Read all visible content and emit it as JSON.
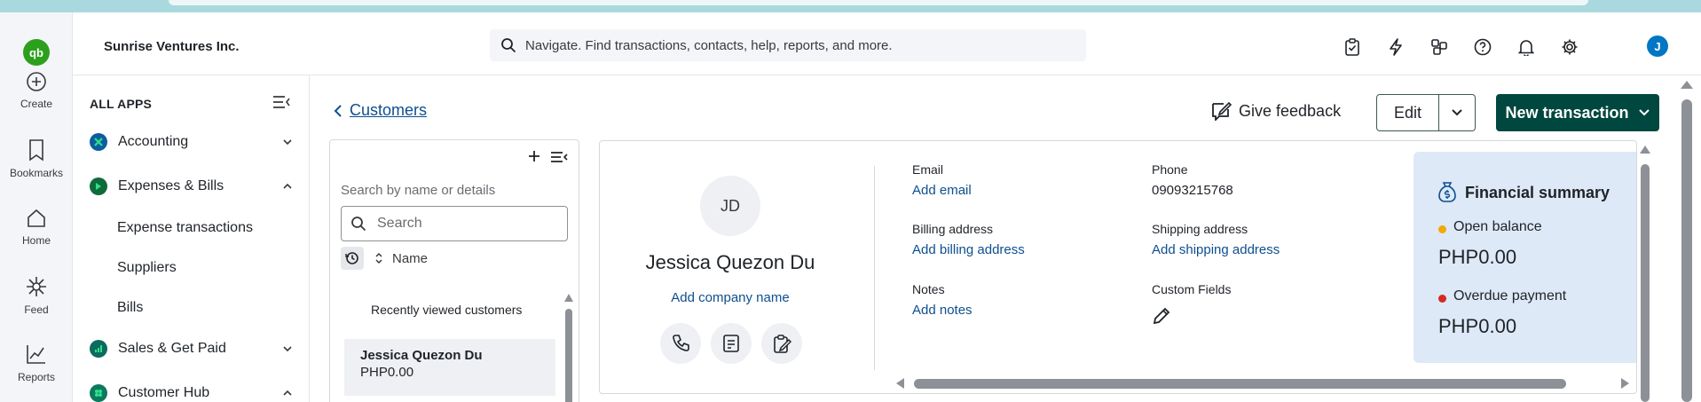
{
  "rail": {
    "items": [
      {
        "label": "Create",
        "icon": "plus-circle-icon"
      },
      {
        "label": "Bookmarks",
        "icon": "bookmark-icon"
      },
      {
        "label": "Home",
        "icon": "home-icon"
      },
      {
        "label": "Feed",
        "icon": "sparkle-icon"
      },
      {
        "label": "Reports",
        "icon": "line-chart-icon"
      }
    ],
    "logo_text": "qb"
  },
  "header": {
    "company": "Sunrise Ventures Inc.",
    "search_placeholder": "Navigate. Find transactions, contacts, help, reports, and more.",
    "avatar_initial": "J"
  },
  "nav": {
    "title": "ALL APPS",
    "items": [
      {
        "label": "Accounting",
        "color": "#0b5e9d",
        "expanded": false
      },
      {
        "label": "Expenses & Bills",
        "color": "#0f6b3a",
        "expanded": true
      },
      {
        "label": "Sales & Get Paid",
        "color": "#0b6b5e",
        "expanded": false
      },
      {
        "label": "Customer Hub",
        "color": "#0b7a5e",
        "expanded": true
      }
    ],
    "subitems": [
      "Expense transactions",
      "Suppliers",
      "Bills"
    ]
  },
  "main": {
    "back_label": "Customers",
    "feedback_label": "Give feedback",
    "edit_label": "Edit",
    "new_transaction_label": "New transaction"
  },
  "customer_list": {
    "hint": "Search by name or details",
    "search_placeholder": "Search",
    "sort_label": "Name",
    "recent_heading": "Recently viewed customers",
    "rows": [
      {
        "name": "Jessica Quezon Du",
        "balance": "PHP0.00"
      }
    ]
  },
  "customer": {
    "initials": "JD",
    "name": "Jessica Quezon Du",
    "add_company": "Add company name",
    "email_label": "Email",
    "email_link": "Add email",
    "phone_label": "Phone",
    "phone_value": "09093215768",
    "billing_label": "Billing address",
    "billing_link": "Add billing address",
    "shipping_label": "Shipping address",
    "shipping_link": "Add shipping address",
    "notes_label": "Notes",
    "notes_link": "Add notes",
    "custom_fields_label": "Custom Fields"
  },
  "financial_summary": {
    "title": "Financial summary",
    "open_balance_label": "Open balance",
    "open_balance_value": "PHP0.00",
    "open_balance_color": "#f2a900",
    "overdue_label": "Overdue payment",
    "overdue_value": "PHP0.00",
    "overdue_color": "#d52b1e"
  },
  "colors": {
    "brand_green": "#2ca01c",
    "primary_button": "#00473f",
    "link": "#0d4f8f"
  }
}
